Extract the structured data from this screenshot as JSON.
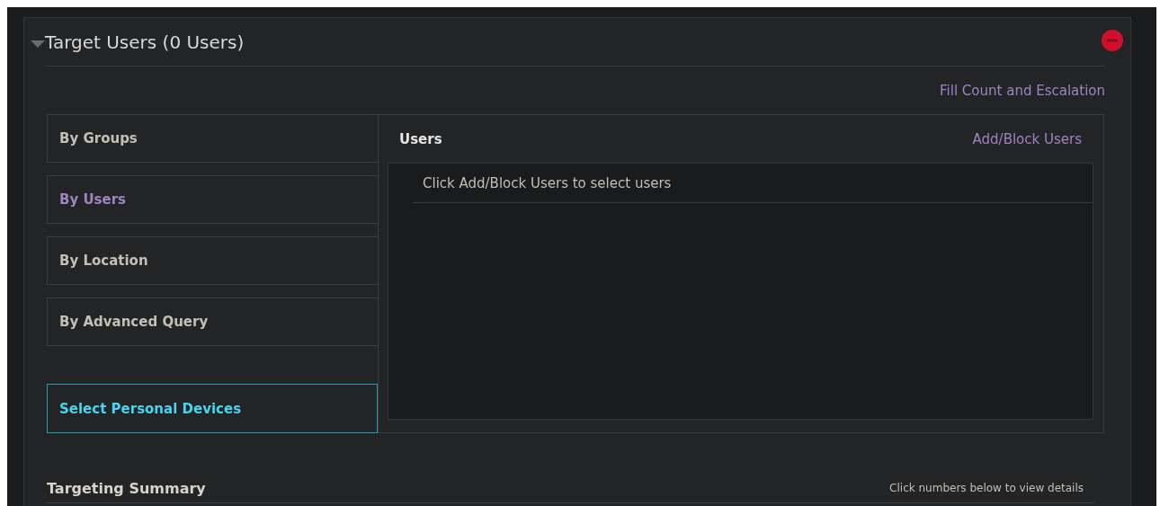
{
  "section": {
    "title": "Target Users (0 Users)",
    "expanded": true
  },
  "fill_count_link": "Fill Count and Escalation",
  "tabs": [
    {
      "label": "By Groups",
      "selected": false
    },
    {
      "label": "By Users",
      "selected": true
    },
    {
      "label": "By Location",
      "selected": false
    },
    {
      "label": "By Advanced Query",
      "selected": false
    }
  ],
  "personal_devices_button": "Select Personal Devices",
  "users_panel": {
    "title": "Users",
    "action": "Add/Block Users",
    "rows": [
      "Click Add/Block Users to select users"
    ]
  },
  "summary": {
    "title": "Targeting Summary",
    "hint": "Click numbers below to view details"
  }
}
